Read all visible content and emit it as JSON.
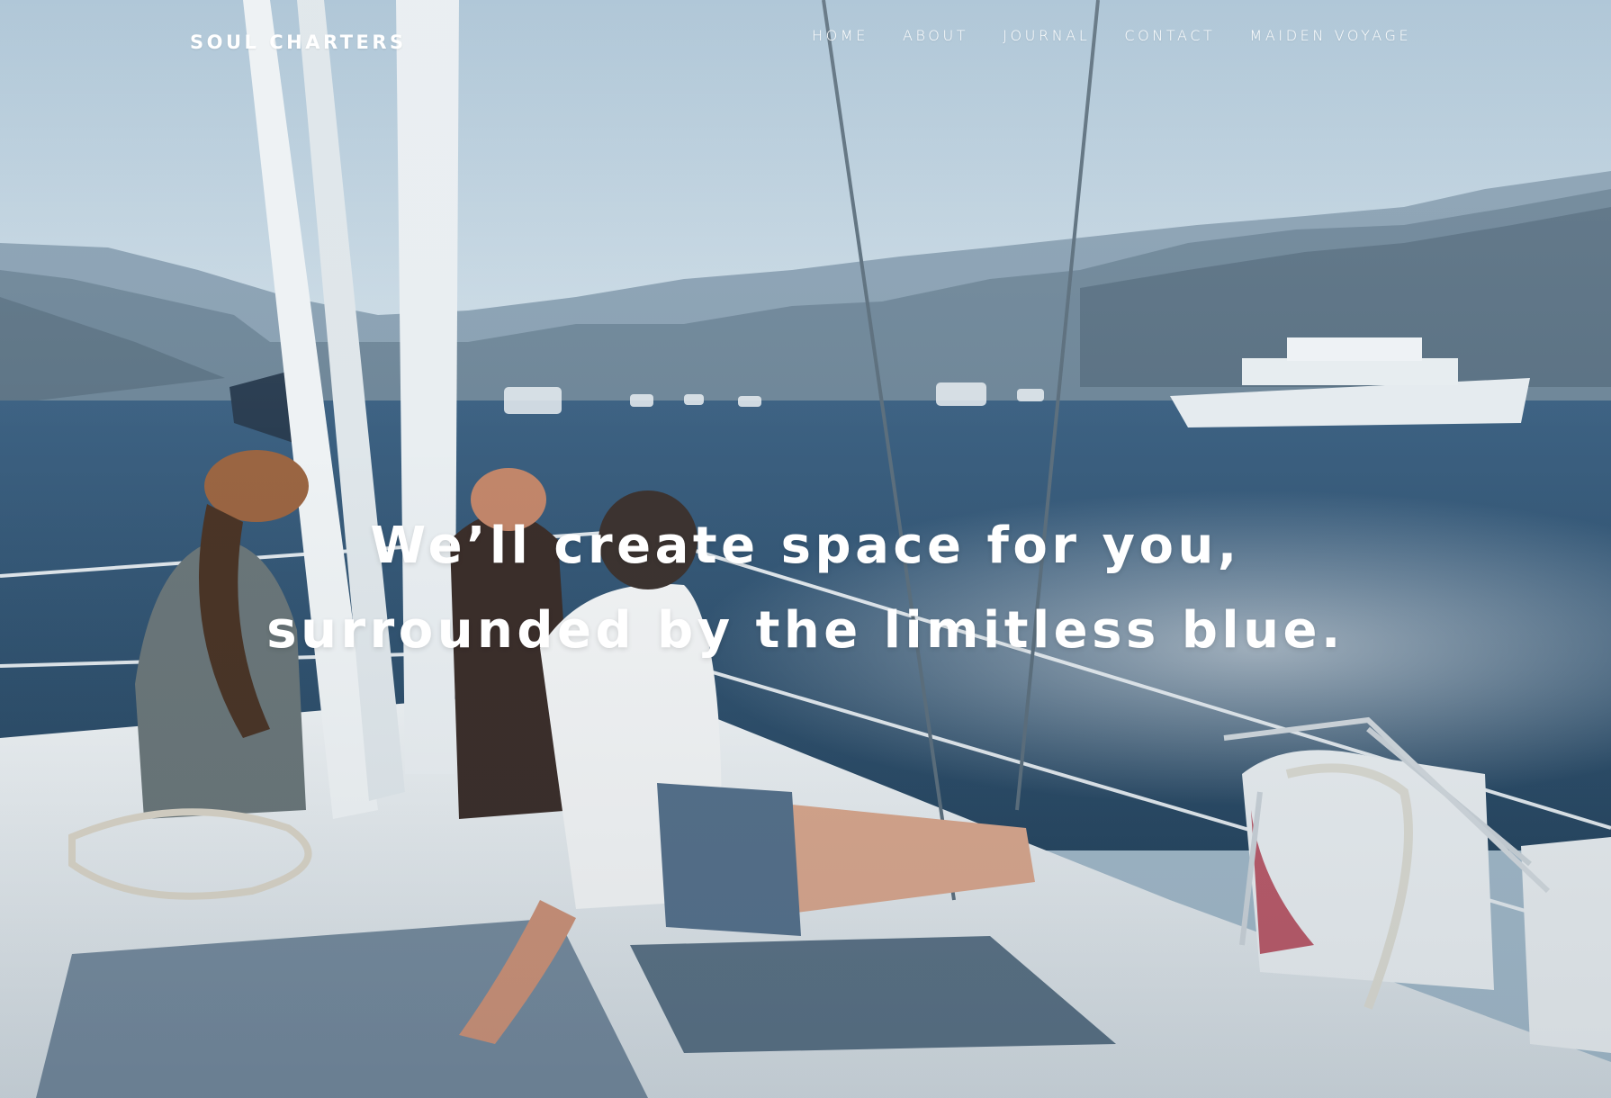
{
  "site": {
    "logo": "SOUL CHARTERS"
  },
  "nav": {
    "items": [
      {
        "label": "HOME"
      },
      {
        "label": "ABOUT"
      },
      {
        "label": "JOURNAL"
      },
      {
        "label": "CONTACT"
      },
      {
        "label": "MAIDEN VOYAGE"
      }
    ]
  },
  "hero": {
    "headline_line1": "We’ll create space for you,",
    "headline_line2": "surrounded by the limitless blue.",
    "image": "sailboat-bow-women-harbor-photo"
  },
  "colors": {
    "sky": "#b9cfdd",
    "sea": "#2f4f6b",
    "deck": "#e6ecef",
    "text": "#ffffff"
  }
}
